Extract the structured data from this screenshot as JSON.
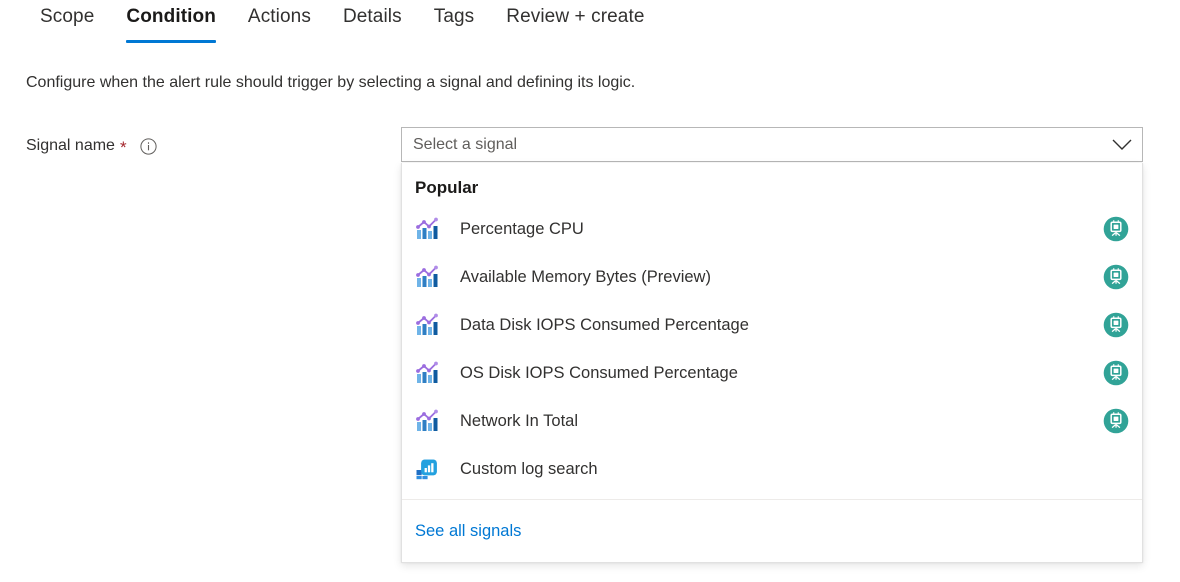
{
  "tabs": [
    {
      "label": "Scope",
      "active": false
    },
    {
      "label": "Condition",
      "active": true
    },
    {
      "label": "Actions",
      "active": false
    },
    {
      "label": "Details",
      "active": false
    },
    {
      "label": "Tags",
      "active": false
    },
    {
      "label": "Review + create",
      "active": false
    }
  ],
  "description": "Configure when the alert rule should trigger by selecting a signal and defining its logic.",
  "form": {
    "signal_name_label": "Signal name",
    "required_marker": "*",
    "info_icon": "info-icon"
  },
  "combobox": {
    "placeholder": "Select a signal",
    "chevron_icon": "chevron-down-icon"
  },
  "dropdown": {
    "group_header": "Popular",
    "items": [
      {
        "label": "Percentage CPU",
        "icon": "metric-chart-icon",
        "badge": "virtual-machine-icon"
      },
      {
        "label": "Available Memory Bytes (Preview)",
        "icon": "metric-chart-icon",
        "badge": "virtual-machine-icon"
      },
      {
        "label": "Data Disk IOPS Consumed Percentage",
        "icon": "metric-chart-icon",
        "badge": "virtual-machine-icon"
      },
      {
        "label": "OS Disk IOPS Consumed Percentage",
        "icon": "metric-chart-icon",
        "badge": "virtual-machine-icon"
      },
      {
        "label": "Network In Total",
        "icon": "metric-chart-icon",
        "badge": "virtual-machine-icon"
      },
      {
        "label": "Custom log search",
        "icon": "log-search-icon",
        "badge": ""
      }
    ],
    "footer_link": "See all signals"
  },
  "colors": {
    "accent_blue": "#0078d4",
    "required_red": "#a4262c",
    "badge_teal": "#31a397",
    "text_primary": "#323130",
    "placeholder_gray": "#605e5c",
    "icon_purple": "#9b6ddf",
    "icon_blue_dark": "#0a5fa8",
    "icon_blue_light": "#5ea9e8"
  }
}
